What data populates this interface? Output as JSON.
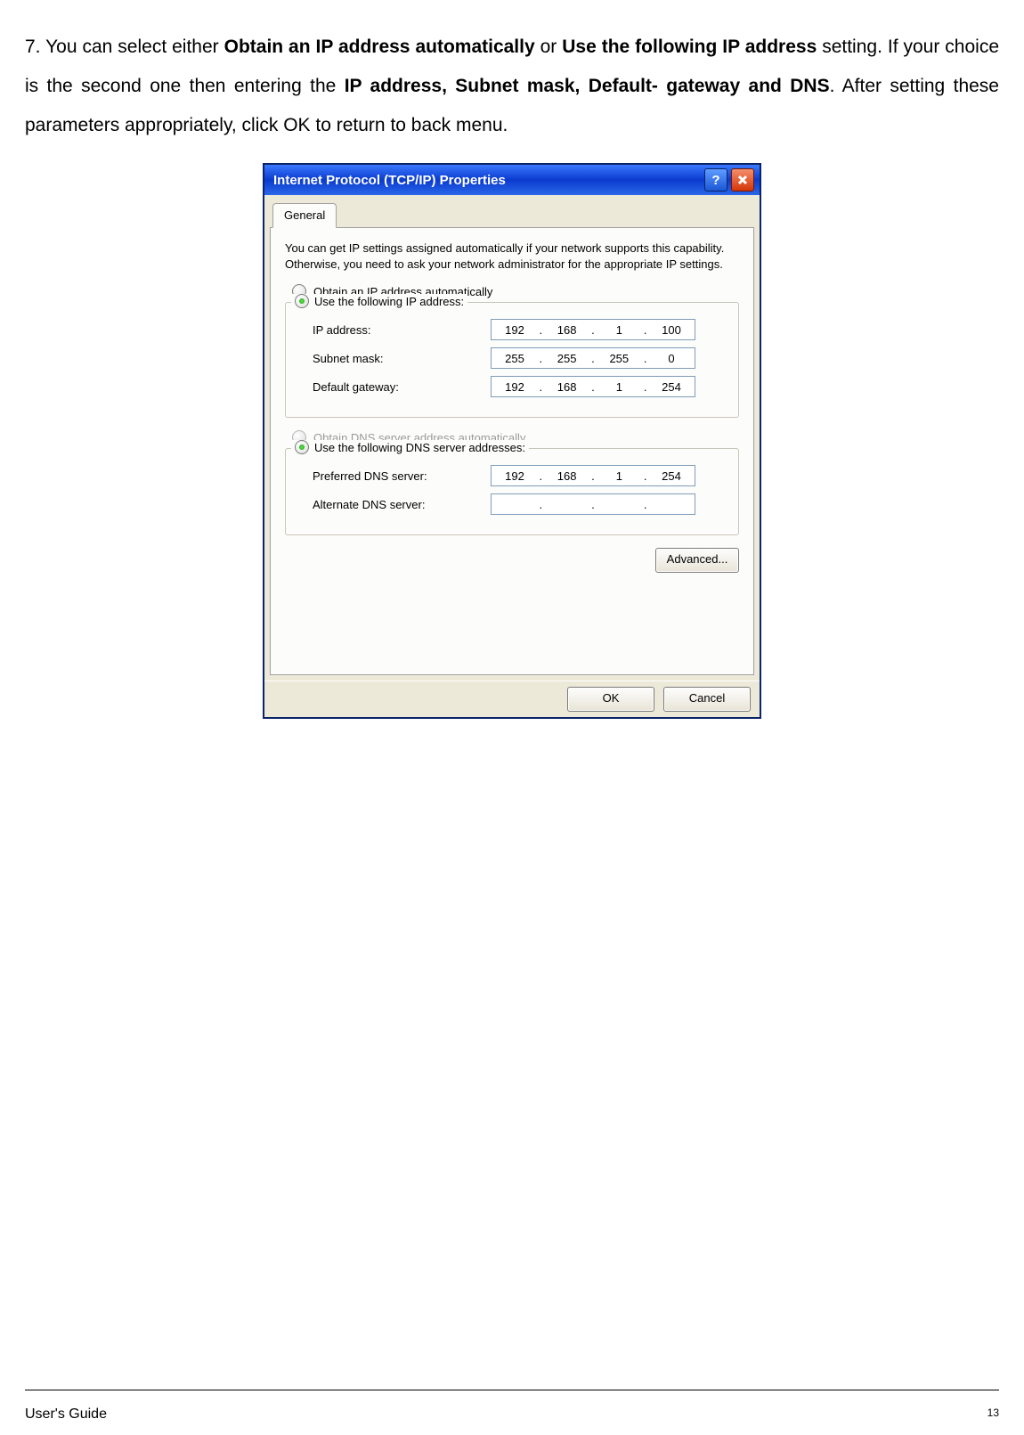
{
  "instruction": {
    "prefix": "7.  You  can  select  either ",
    "bold1": "Obtain  an  IP  address  automatically",
    "mid1": "  or  ",
    "bold2": "Use  the  following IP  address",
    "mid2": " setting.   If   your   choice   is   the   second   one   then   entering   the  ",
    "bold3": "IP  address, Subnet   mask,   Default- gateway and DNS",
    "suffix": ". After setting these parameters appropriately, click OK to return to back menu."
  },
  "dialog": {
    "title": "Internet Protocol (TCP/IP) Properties",
    "help": "?",
    "tab": "General",
    "desc": "You can get IP settings assigned automatically if your network supports this capability. Otherwise, you need to ask your network administrator for the appropriate IP settings.",
    "radio_auto": "Obtain an IP address automatically",
    "radio_use": "Use the following IP address:",
    "fields": {
      "ip_label": "IP address:",
      "ip": [
        "192",
        "168",
        "1",
        "100"
      ],
      "subnet_label": "Subnet mask:",
      "subnet": [
        "255",
        "255",
        "255",
        "0"
      ],
      "gateway_label": "Default gateway:",
      "gateway": [
        "192",
        "168",
        "1",
        "254"
      ]
    },
    "radio_dns_auto": "Obtain DNS server address automatically",
    "radio_dns_use": "Use the following DNS server addresses:",
    "dns": {
      "pref_label": "Preferred DNS server:",
      "pref": [
        "192",
        "168",
        "1",
        "254"
      ],
      "alt_label": "Alternate DNS server:",
      "alt": [
        "",
        "",
        "",
        ""
      ]
    },
    "advanced": "Advanced...",
    "ok": "OK",
    "cancel": "Cancel"
  },
  "footer": {
    "left": "User's Guide",
    "page": "13"
  }
}
